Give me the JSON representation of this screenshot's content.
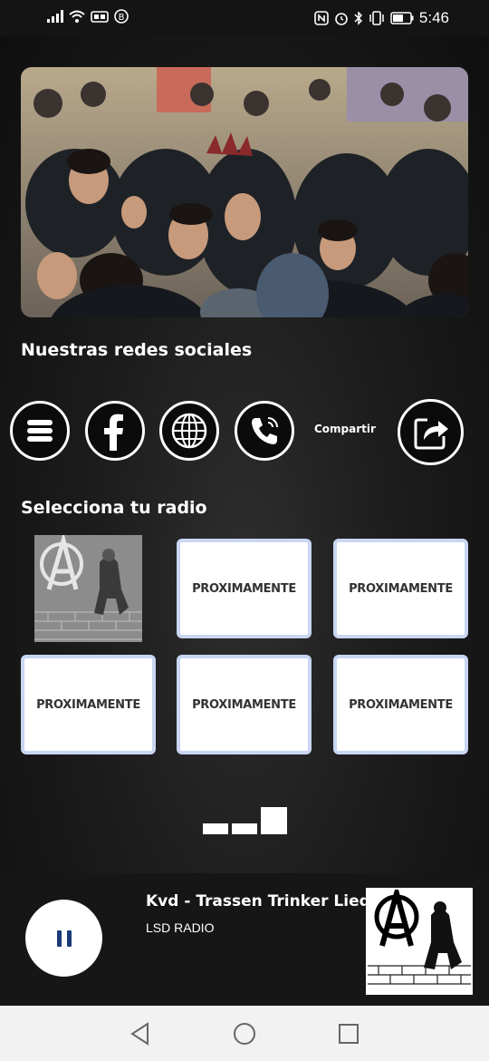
{
  "status_bar": {
    "time": "5:46",
    "left_icons": [
      "signal-icon",
      "wifi-icon",
      "hd-icon",
      "notification-b-icon"
    ],
    "right_icons": [
      "nfc-icon",
      "alarm-icon",
      "bluetooth-icon",
      "vibrate-icon",
      "battery-icon"
    ]
  },
  "sections": {
    "social_title": "Nuestras redes sociales",
    "radio_title": "Selecciona tu radio"
  },
  "social": {
    "buttons": [
      "menu-icon",
      "facebook-icon",
      "globe-icon",
      "phone-icon"
    ],
    "share_label": "Compartir",
    "share_icon": "share-icon"
  },
  "radios": {
    "tiles": [
      {
        "label": "PROXIMAMENTE"
      },
      {
        "label": "PROXIMAMENTE"
      },
      {
        "label": "PROXIMAMENTE"
      },
      {
        "label": "PROXIMAMENTE"
      },
      {
        "label": "PROXIMAMENTE"
      }
    ]
  },
  "player": {
    "track": "Kvd - Trassen Trinker Lied",
    "station": "LSD RADIO",
    "state": "playing",
    "button_icon": "pause-icon"
  },
  "navbar": {
    "buttons": [
      "back-icon",
      "home-icon",
      "recents-icon"
    ]
  },
  "colors": {
    "background": "#1c1c1c",
    "tile_border": "#c9d6f2",
    "pause_icon": "#1a3a7a"
  }
}
